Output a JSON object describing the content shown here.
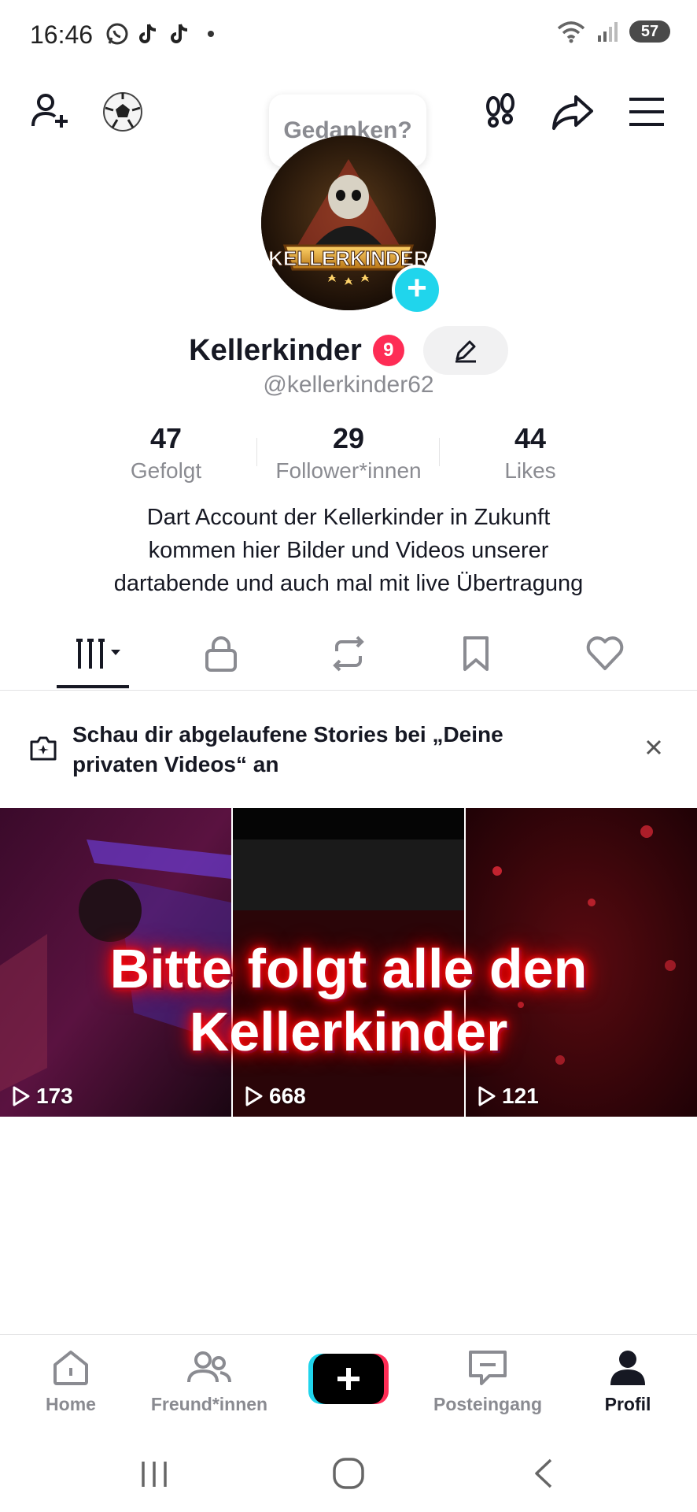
{
  "status_bar": {
    "time": "16:46",
    "battery": "57"
  },
  "header": {
    "thought_prompt": "Gedanken?"
  },
  "profile": {
    "display_name": "Kellerkinder",
    "notification_count": "9",
    "handle": "@kellerkinder62",
    "stats": [
      {
        "value": "47",
        "label": "Gefolgt"
      },
      {
        "value": "29",
        "label": "Follower*innen"
      },
      {
        "value": "44",
        "label": "Likes"
      }
    ],
    "bio_lines": [
      "Dart Account der Kellerkinder in Zukunft",
      "kommen hier Bilder und Videos unserer",
      "dartabende und auch mal mit live Übertragung"
    ],
    "avatar_text": "KELLERKINDER"
  },
  "tabs": [
    "videos-grid-icon",
    "lock-icon",
    "repost-icon",
    "bookmark-icon",
    "heart-icon"
  ],
  "banner": {
    "text": "Schau dir abgelaufene Stories bei „Deine privaten Videos“ an"
  },
  "videos": [
    {
      "views": "173"
    },
    {
      "views": "668"
    },
    {
      "views": "121"
    }
  ],
  "video_overlay": {
    "line1": "Bitte  folgt alle den",
    "line2": "Kellerkinder"
  },
  "nav": {
    "home": "Home",
    "friends": "Freund*innen",
    "inbox": "Posteingang",
    "profile": "Profil"
  },
  "colors": {
    "accent_cyan": "#20d5ec",
    "accent_red": "#fe2c55",
    "text": "#161823",
    "muted": "#8a8b91"
  }
}
